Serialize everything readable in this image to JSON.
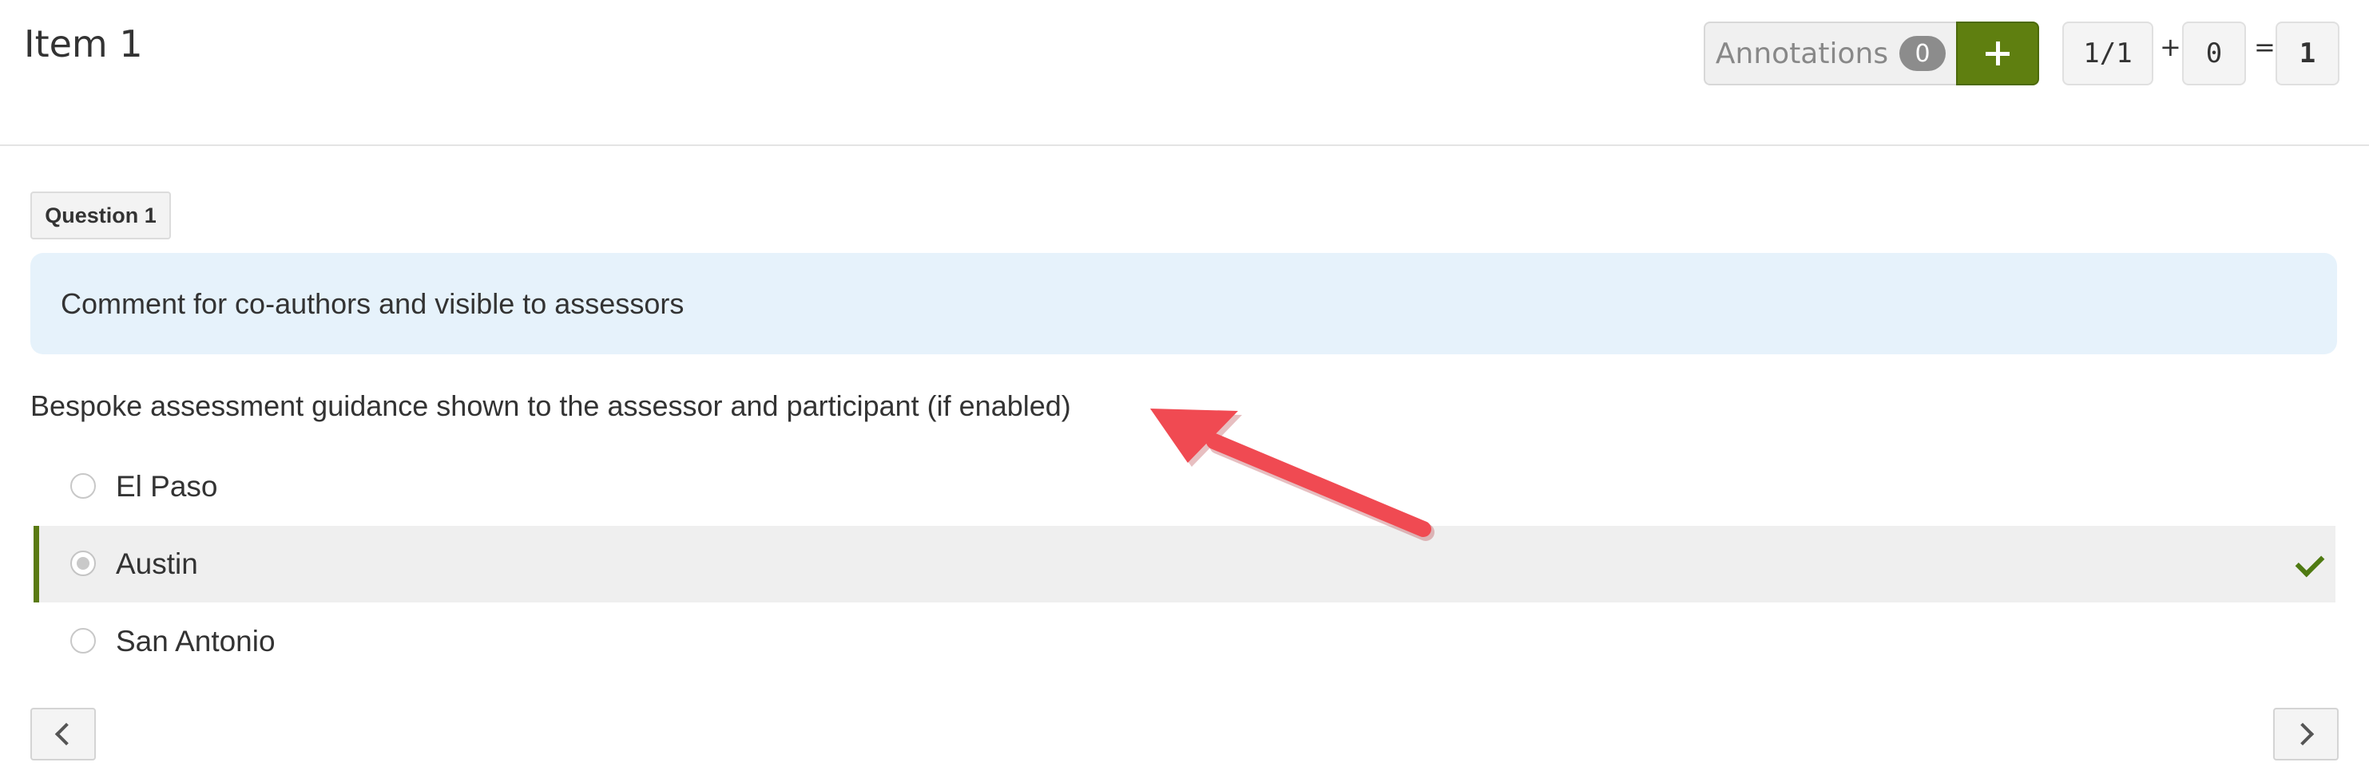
{
  "header": {
    "title": "Item 1",
    "annotations_label": "Annotations",
    "annotations_count": "0",
    "add_icon": "plus-icon",
    "score": {
      "fraction": "1/1",
      "plus": "+",
      "bonus": "0",
      "equals": "=",
      "total": "1"
    }
  },
  "question": {
    "tag": "Question 1",
    "comment": "Comment for co-authors and visible to assessors",
    "guidance": "Bespoke assessment guidance shown to the assessor and participant (if enabled)",
    "options": [
      {
        "label": "El Paso",
        "selected": false
      },
      {
        "label": "Austin",
        "selected": true
      },
      {
        "label": "San Antonio",
        "selected": false
      }
    ]
  },
  "navigation": {
    "prev_icon": "chevron-left-icon",
    "next_icon": "chevron-right-icon"
  },
  "colors": {
    "accent": "#5f7f10",
    "comment_bg": "#e6f2fb",
    "arrow": "#f04a52"
  }
}
